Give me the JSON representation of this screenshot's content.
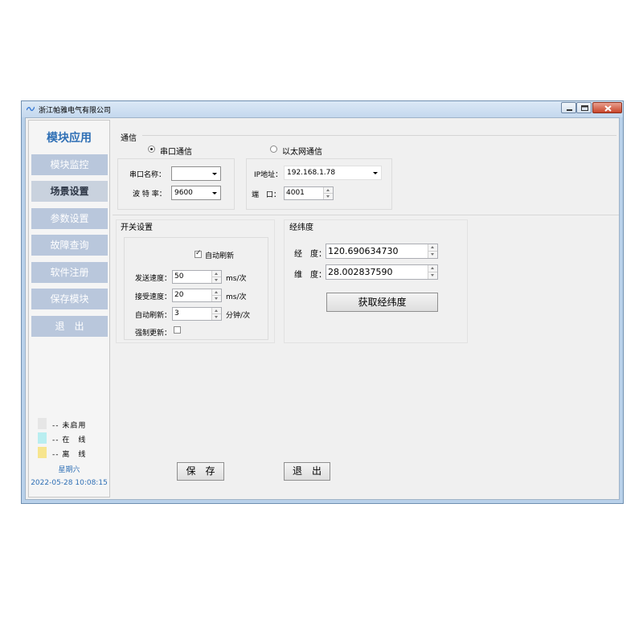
{
  "window": {
    "title": "浙江帕雅电气有限公司"
  },
  "sidebar": {
    "title": "模块应用",
    "items": [
      {
        "label": "模块监控",
        "active": false
      },
      {
        "label": "场景设置",
        "active": true
      },
      {
        "label": "参数设置",
        "active": false
      },
      {
        "label": "故障查询",
        "active": false
      },
      {
        "label": "软件注册",
        "active": false
      },
      {
        "label": "保存模块",
        "active": false
      },
      {
        "label": "退　出",
        "active": false
      }
    ],
    "legend": [
      {
        "label": "-- 未启用",
        "color": "#e6e6e6"
      },
      {
        "label": "-- 在　线",
        "color": "#b9eef0"
      },
      {
        "label": "-- 离　线",
        "color": "#f7e58e"
      }
    ],
    "weekday": "星期六",
    "datetime": "2022-05-28 10:08:15"
  },
  "comm": {
    "title": "通信",
    "serial_label": "串口通信",
    "serial_selected": true,
    "ethernet_label": "以太网通信",
    "ethernet_selected": false,
    "port_name_label": "串口名称：",
    "port_name_value": "",
    "baud_label": "波 特 率：",
    "baud_value": "9600",
    "ip_label": "IP地址：",
    "ip_value": "192.168.1.78",
    "port_label": "端　口：",
    "port_value": "4001"
  },
  "switch": {
    "title": "开关设置",
    "auto_refresh_label": "自动刷新",
    "auto_refresh_checked": true,
    "send_speed_label": "发送速度：",
    "send_speed_value": "50",
    "send_speed_unit": "ms/次",
    "recv_speed_label": "接受速度：",
    "recv_speed_value": "20",
    "recv_speed_unit": "ms/次",
    "auto_refresh_interval_label": "自动刷新：",
    "auto_refresh_interval_value": "3",
    "auto_refresh_interval_unit": "分钟/次",
    "force_update_label": "强制更新：",
    "force_update_checked": false
  },
  "geo": {
    "title": "经纬度",
    "longitude_label": "经　度：",
    "longitude_value": "120.690634730",
    "latitude_label": "维　度：",
    "latitude_value": "28.002837590",
    "fetch_button": "获取经纬度"
  },
  "footer": {
    "save_button": "保　存",
    "exit_button": "退　出"
  }
}
